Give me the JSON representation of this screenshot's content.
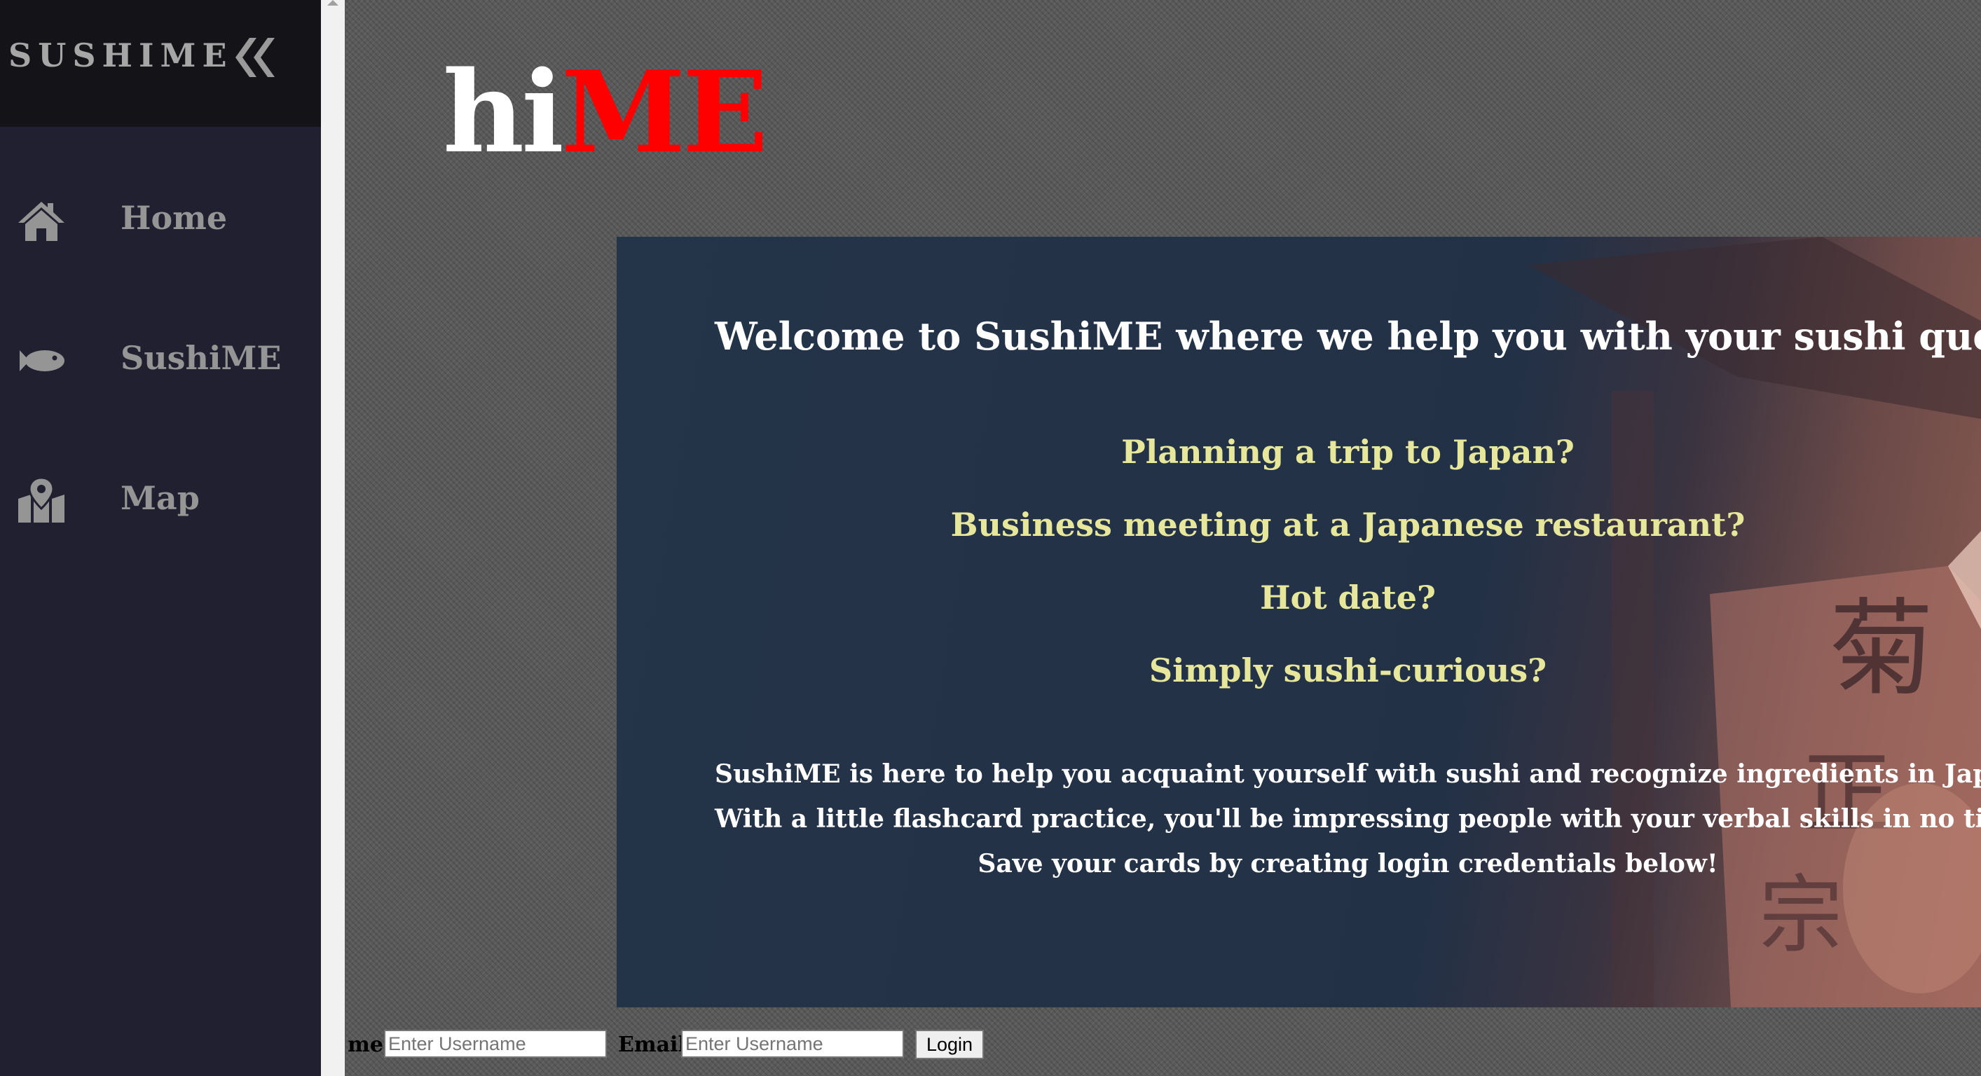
{
  "sidebar": {
    "brand": "SUSHIME",
    "collapse_icon": "double-chevron-left-icon",
    "items": [
      {
        "label": "Home",
        "icon": "home-icon"
      },
      {
        "label": "SushiME",
        "icon": "fish-icon"
      },
      {
        "label": "Map",
        "icon": "map-marker-icon"
      }
    ]
  },
  "header": {
    "title_part1": "hi",
    "title_part2": "ME"
  },
  "hero": {
    "welcome": "Welcome to SushiME where we help you with your sushi queries!",
    "questions": [
      "Planning a trip to Japan?",
      "Business meeting at a Japanese restaurant?",
      "Hot date?",
      "Simply sushi-curious?"
    ],
    "description": [
      "SushiME is here to help you acquaint yourself with sushi and recognize ingredients in Japanese.",
      "With a little flashcard practice, you'll be impressing people with your verbal skills in no time!",
      "Save your cards by creating login credentials below!"
    ]
  },
  "login": {
    "username_label": "me",
    "username_placeholder": "Enter Username",
    "email_label": "Email",
    "email_placeholder": "Enter Username",
    "button_label": "Login"
  },
  "colors": {
    "sidebar_bg": "#202030",
    "sidebar_header_bg": "#141418",
    "title_white": "#ffffff",
    "title_red": "#ff0000",
    "question_color": "#e6e79a",
    "hero_bg": "#243449"
  }
}
